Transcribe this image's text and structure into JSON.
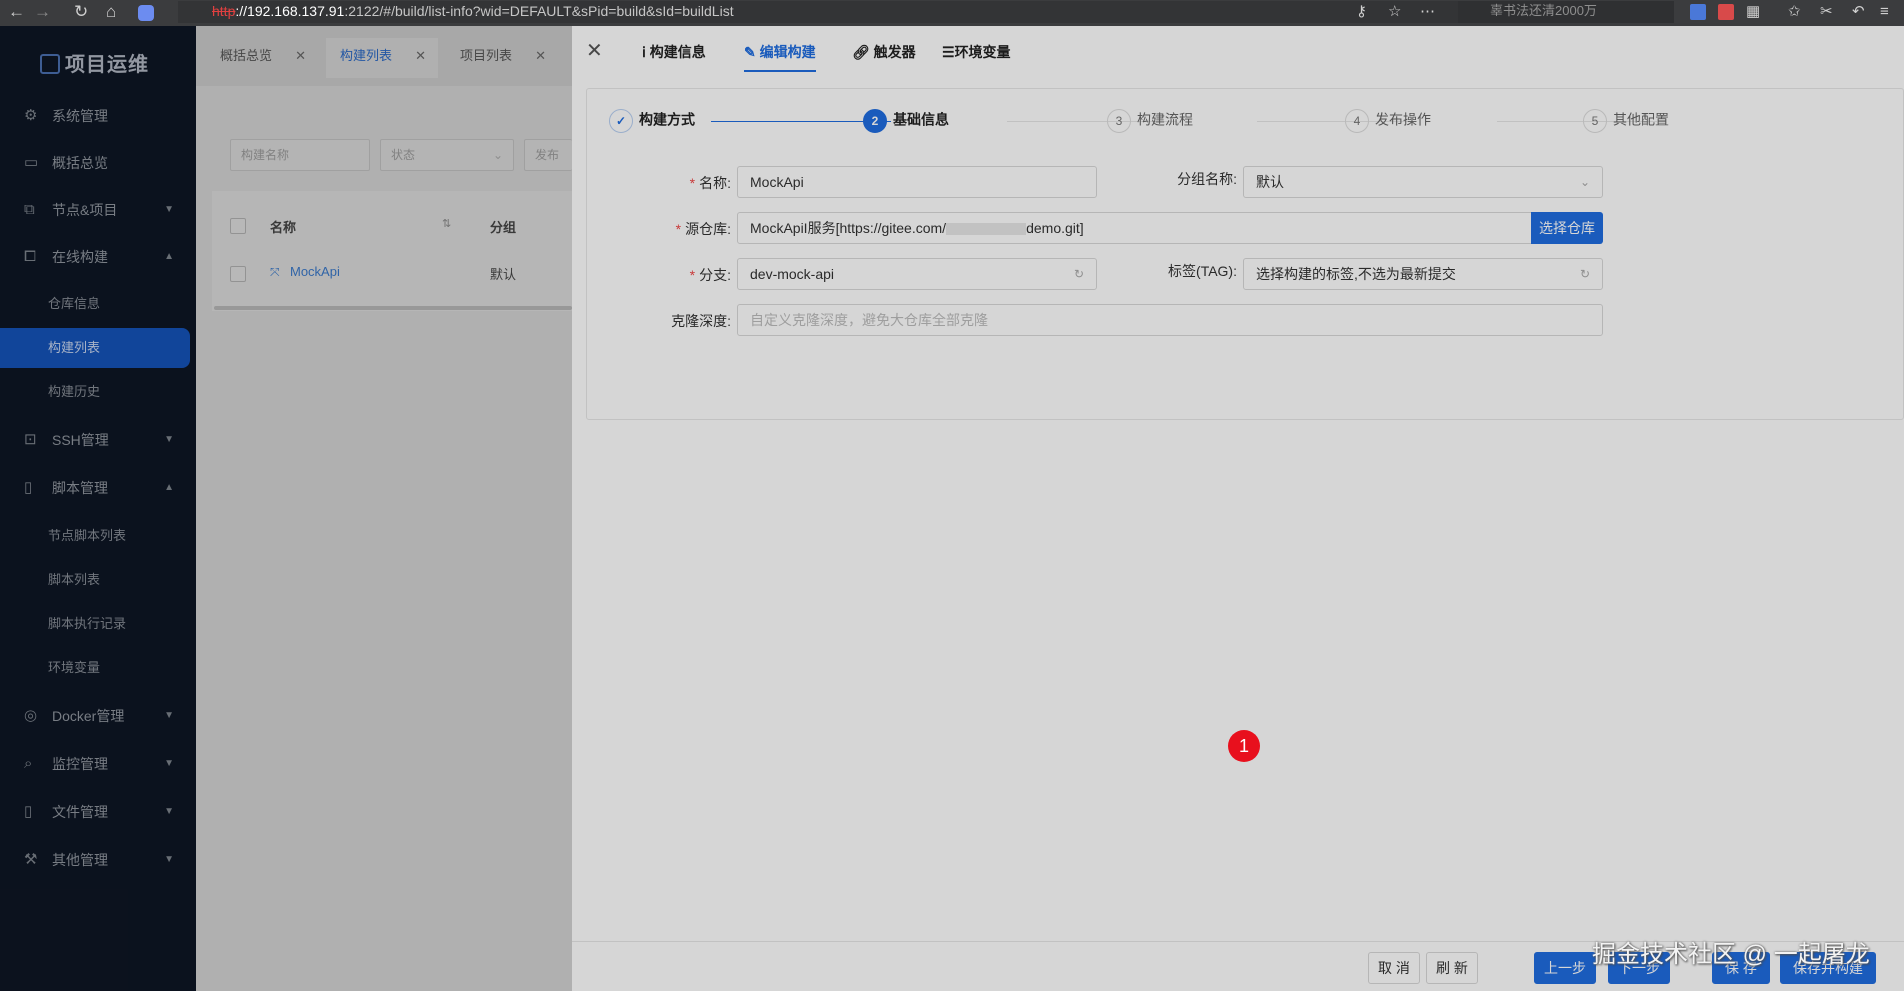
{
  "browser": {
    "url_proto": "http",
    "url_host": "://192.168.137.91",
    "url_rest": ":2122/#/build/list-info?wid=DEFAULT&sPid=build&sId=buildList",
    "search_placeholder": "辜书法还清2000万"
  },
  "sidebar": {
    "logo": "项目运维",
    "items": [
      {
        "label": "系统管理",
        "icon": "gear-icon"
      },
      {
        "label": "概括总览",
        "icon": "monitor-icon"
      },
      {
        "label": "节点&项目",
        "icon": "cluster-icon"
      },
      {
        "label": "在线构建",
        "icon": "build-icon"
      },
      {
        "label": "SSH管理",
        "icon": "terminal-icon"
      },
      {
        "label": "脚本管理",
        "icon": "file-icon"
      },
      {
        "label": "Docker管理",
        "icon": "docker-icon"
      },
      {
        "label": "监控管理",
        "icon": "search-icon"
      },
      {
        "label": "文件管理",
        "icon": "file-icon"
      },
      {
        "label": "其他管理",
        "icon": "tool-icon"
      }
    ],
    "build_sub": [
      "仓库信息",
      "构建列表",
      "构建历史"
    ],
    "script_sub": [
      "节点脚本列表",
      "脚本列表",
      "脚本执行记录",
      "环境变量"
    ]
  },
  "page_tabs": [
    "概括总览",
    "构建列表",
    "项目列表"
  ],
  "filters": {
    "name_placeholder": "构建名称",
    "status_placeholder": "状态",
    "publish_placeholder": "发布"
  },
  "table": {
    "headers": [
      "名称",
      "分组"
    ],
    "rows": [
      {
        "name": "MockApi",
        "group": "默认"
      }
    ]
  },
  "drawer": {
    "tabs": [
      "构建信息",
      "编辑构建",
      "触发器",
      "环境变量"
    ],
    "steps": [
      {
        "num": "✓",
        "label": "构建方式"
      },
      {
        "num": "2",
        "label": "基础信息"
      },
      {
        "num": "3",
        "label": "构建流程"
      },
      {
        "num": "4",
        "label": "发布操作"
      },
      {
        "num": "5",
        "label": "其他配置"
      }
    ],
    "form": {
      "name_label": "名称",
      "name_value": "MockApi",
      "group_label": "分组名称",
      "group_value": "默认",
      "repo_label": "源仓库",
      "repo_value_start": "MockApiI服务[https://gitee.com/",
      "repo_value_end": "demo.git]",
      "repo_button": "选择仓库",
      "branch_label": "分支",
      "branch_value": "dev-mock-api",
      "tag_label": "标签(TAG)",
      "tag_value": "选择构建的标签,不选为最新提交",
      "depth_label": "克隆深度",
      "depth_placeholder": "自定义克隆深度，避免大仓库全部克隆"
    },
    "footer": {
      "cancel": "取 消",
      "refresh": "刷 新",
      "prev": "上一步",
      "next": "下一步",
      "save": "保 存",
      "save_build": "保存并构建"
    }
  },
  "badge": "1",
  "watermark": "掘金技术社区 @ 一起屠龙",
  "colors": {
    "accent": "#1f6de0",
    "sidebar": "#0e1624",
    "required": "#f04646",
    "badge": "#e8101d"
  }
}
